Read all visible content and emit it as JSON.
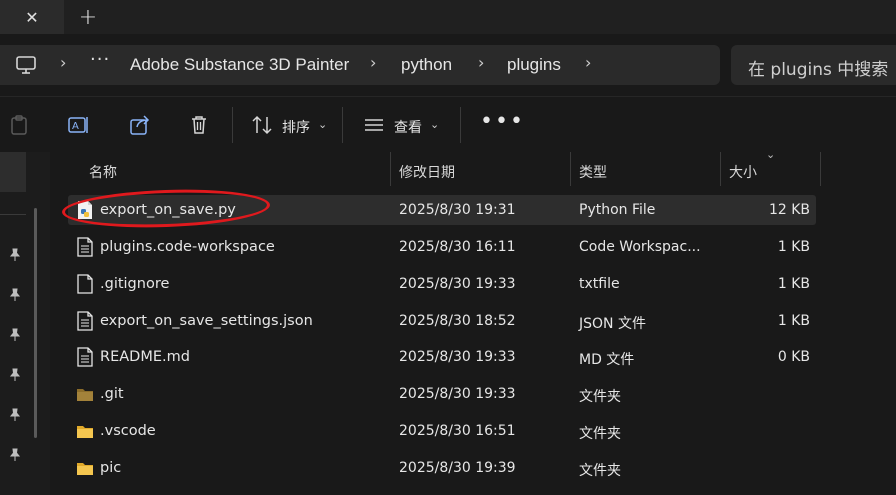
{
  "tabs": {
    "close_glyph": "✕",
    "new_glyph": "+"
  },
  "address": {
    "more": "···",
    "crumbs": [
      "Adobe Substance 3D Painter",
      "python",
      "plugins"
    ],
    "separator": "›",
    "search_placeholder": "在 plugins 中搜索"
  },
  "toolbar": {
    "sort_label": "排序",
    "view_label": "查看",
    "more": "•••",
    "chevron": "⌄"
  },
  "columns": {
    "name": "名称",
    "date": "修改日期",
    "type": "类型",
    "size": "大小"
  },
  "files": [
    {
      "name": "export_on_save.py",
      "date": "2025/8/30 19:31",
      "type": "Python File",
      "size": "12 KB",
      "icon": "python-file-icon",
      "selected": true
    },
    {
      "name": "plugins.code-workspace",
      "date": "2025/8/30 16:11",
      "type": "Code Workspac...",
      "size": "1 KB",
      "icon": "document-icon"
    },
    {
      "name": ".gitignore",
      "date": "2025/8/30 19:33",
      "type": "txtfile",
      "size": "1 KB",
      "icon": "blank-file-icon"
    },
    {
      "name": "export_on_save_settings.json",
      "date": "2025/8/30 18:52",
      "type": "JSON 文件",
      "size": "1 KB",
      "icon": "document-icon"
    },
    {
      "name": "README.md",
      "date": "2025/8/30 19:33",
      "type": "MD 文件",
      "size": "0 KB",
      "icon": "document-icon"
    },
    {
      "name": ".git",
      "date": "2025/8/30 19:33",
      "type": "文件夹",
      "size": "",
      "icon": "dark-folder-icon"
    },
    {
      "name": ".vscode",
      "date": "2025/8/30 16:51",
      "type": "文件夹",
      "size": "",
      "icon": "folder-icon"
    },
    {
      "name": "pic",
      "date": "2025/8/30 19:39",
      "type": "文件夹",
      "size": "",
      "icon": "folder-icon"
    }
  ],
  "colors": {
    "background": "#191919",
    "selection": "#2d2d2d",
    "annotation_ring": "#e0191d",
    "folder": "#f4c64f"
  }
}
